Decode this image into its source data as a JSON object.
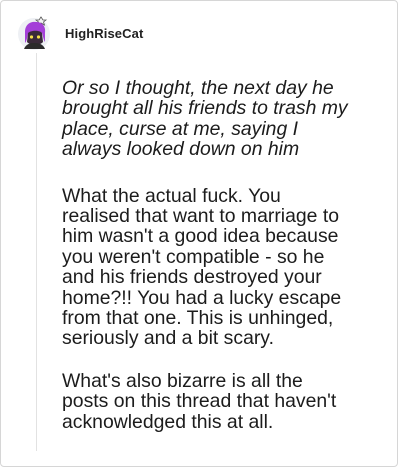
{
  "comment": {
    "author": "HighRiseCat",
    "avatar_icon": "purple-haired-cat-avatar-icon",
    "quote": "Or so I thought, the next day he\nbrought all his friends to trash my\nplace, curse at me, saying I\nalways looked down on him",
    "paragraphs": [
      "What the actual fuck. You\nrealised that want to marriage to\nhim wasn't a good idea because\nyou weren't compatible - so he\nand his friends destroyed your\nhome?!! You had a lucky escape\nfrom that one. This is unhinged,\nseriously and a bit scary.",
      "What's also bizarre is all the\nposts on this thread that haven't\nacknowledged this at all."
    ]
  },
  "colors": {
    "hair": "#a43fd8",
    "text": "#1c1c1c",
    "border": "#d6d6d6"
  }
}
